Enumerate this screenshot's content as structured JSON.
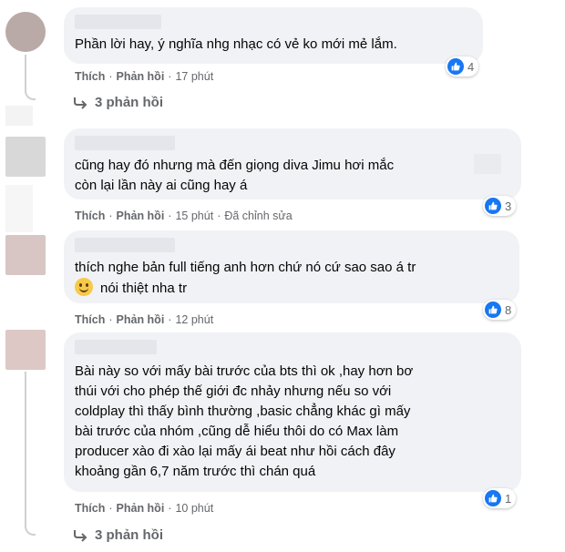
{
  "comments": [
    {
      "lines": [
        "Phần lời hay, ý nghĩa nhg nhạc có vẻ ko mới mẻ lắm."
      ],
      "like_label": "Thích",
      "reply_label": "Phản hồi",
      "time": "17 phút",
      "edited": "",
      "reactions": "4",
      "replies_label": "3 phản hồi",
      "avatar_color": "#b9a9a7"
    },
    {
      "lines": [
        "cũng hay đó nhưng mà đến giọng diva Jimu hơi mắc",
        "còn lại lần này ai cũng hay á"
      ],
      "like_label": "Thích",
      "reply_label": "Phản hồi",
      "time": "15 phút",
      "edited": "Đã chỉnh sửa",
      "reactions": "3",
      "avatar_color": "#d8d8d8"
    },
    {
      "lines": [
        "thích nghe bản full tiếng anh hơn chứ nó cứ sao sao á tr",
        "nói thiệt nha tr"
      ],
      "like_label": "Thích",
      "reply_label": "Phản hồi",
      "time": "12 phút",
      "edited": "",
      "reactions": "8",
      "emoji": "slightly-smiling-face-icon",
      "avatar_color": "#d7c6c4"
    },
    {
      "lines": [
        "Bài này so với mấy bài trước của bts thì ok ,hay hơn bơ",
        "thúi với cho phép thế giới đc nhảy nhưng nếu so với",
        "coldplay thì thấy bình thường ,basic chẳng khác gì mấy",
        "bài trước của nhóm ,cũng dễ hiểu thôi do có Max làm",
        "producer xào đi xào lại mấy ái beat như hồi cách đây",
        "khoảng gần 6,7 năm trước thì chán quá"
      ],
      "like_label": "Thích",
      "reply_label": "Phản hồi",
      "time": "10 phút",
      "edited": "",
      "reactions": "1",
      "replies_label": "3 phản hồi",
      "avatar_color": "#ddc8c6"
    }
  ],
  "colors": {
    "bubble": "#f0f2f5",
    "meta_text": "#65676b",
    "like_blue": "#1877f2"
  }
}
